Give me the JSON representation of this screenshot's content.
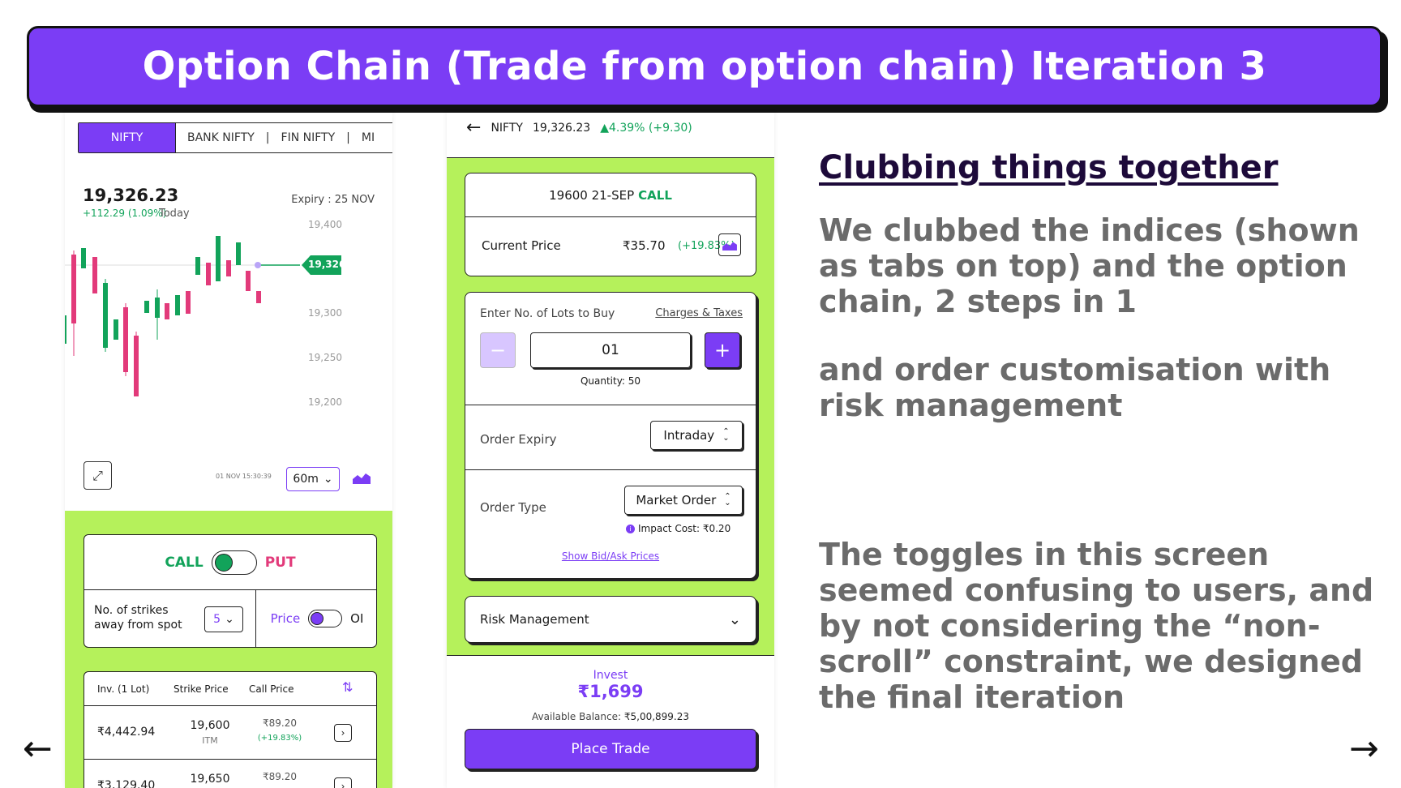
{
  "banner": {
    "title": "Option Chain (Trade from option chain) Iteration 3"
  },
  "phone1": {
    "tabs": [
      "NIFTY",
      "BANK NIFTY",
      "FIN NIFTY",
      "MI"
    ],
    "tab_sep": "|",
    "index_price": "19,326.23",
    "index_change": "+112.29 (1.09%)",
    "today_label": "Today",
    "expiry": "Expiry : 25 NOV",
    "chart_y_ticks": [
      "19,400",
      "19,300",
      "19,250",
      "19,200"
    ],
    "current_price_tag": "19,326",
    "timestamp": "01 NOV 15:30:39",
    "interval": "60m",
    "call_label": "CALL",
    "put_label": "PUT",
    "strikes_label_line1": "No. of strikes",
    "strikes_label_line2": "away from spot",
    "strikes_value": "5",
    "price_label": "Price",
    "oi_label": "OI",
    "chain_headers": {
      "inv": "Inv. (1 Lot)",
      "strike": "Strike Price",
      "call": "Call Price"
    },
    "chain_rows": [
      {
        "inv": "₹4,442.94",
        "strike": "19,600",
        "moneyness": "ITM",
        "price": "₹89.20",
        "change": "(+19.83%)"
      },
      {
        "inv": "₹3,129.40",
        "strike": "19,650",
        "moneyness": "",
        "price": "₹89.20",
        "change": ""
      }
    ]
  },
  "phone2": {
    "header_symbol": "NIFTY",
    "header_price": "19,326.23",
    "header_change": "▲4.39% (+9.30)",
    "contract_name": "19600 21-SEP",
    "contract_type": "CALL",
    "current_price_label": "Current Price",
    "current_price": "₹35.70",
    "current_price_change": "(+19.83%)",
    "lots_label": "Enter No. of Lots to Buy",
    "charges_link": "Charges & Taxes",
    "minus_label": "−",
    "plus_label": "+",
    "lots_value": "01",
    "quantity_note": "Quantity: 50",
    "order_expiry_label": "Order Expiry",
    "order_expiry_value": "Intraday",
    "order_type_label": "Order Type",
    "order_type_value": "Market Order",
    "impact_cost": "Impact Cost: ₹0.20",
    "bid_ask_link": "Show Bid/Ask Prices",
    "risk_label": "Risk Management",
    "invest_label": "Invest",
    "invest_amount": "₹1,699",
    "balance_label": "Available Balance:",
    "balance_value": "₹5,00,899.23",
    "place_trade": "Place Trade"
  },
  "notes": {
    "heading": "Clubbing things together",
    "para1": "We clubbed the indices (shown as tabs on top) and the option chain, 2 steps in 1",
    "para2": "and order customisation with risk management",
    "para3": "The toggles in this screen seemed confusing to users, and by not considering the “non-scroll” constraint, we designed the final iteration"
  },
  "nav": {
    "prev": "←",
    "next": "→"
  },
  "colors": {
    "accent": "#7b3df5",
    "green_bg": "#b5f15b",
    "up": "#12a35a",
    "down": "#e23a7a"
  }
}
